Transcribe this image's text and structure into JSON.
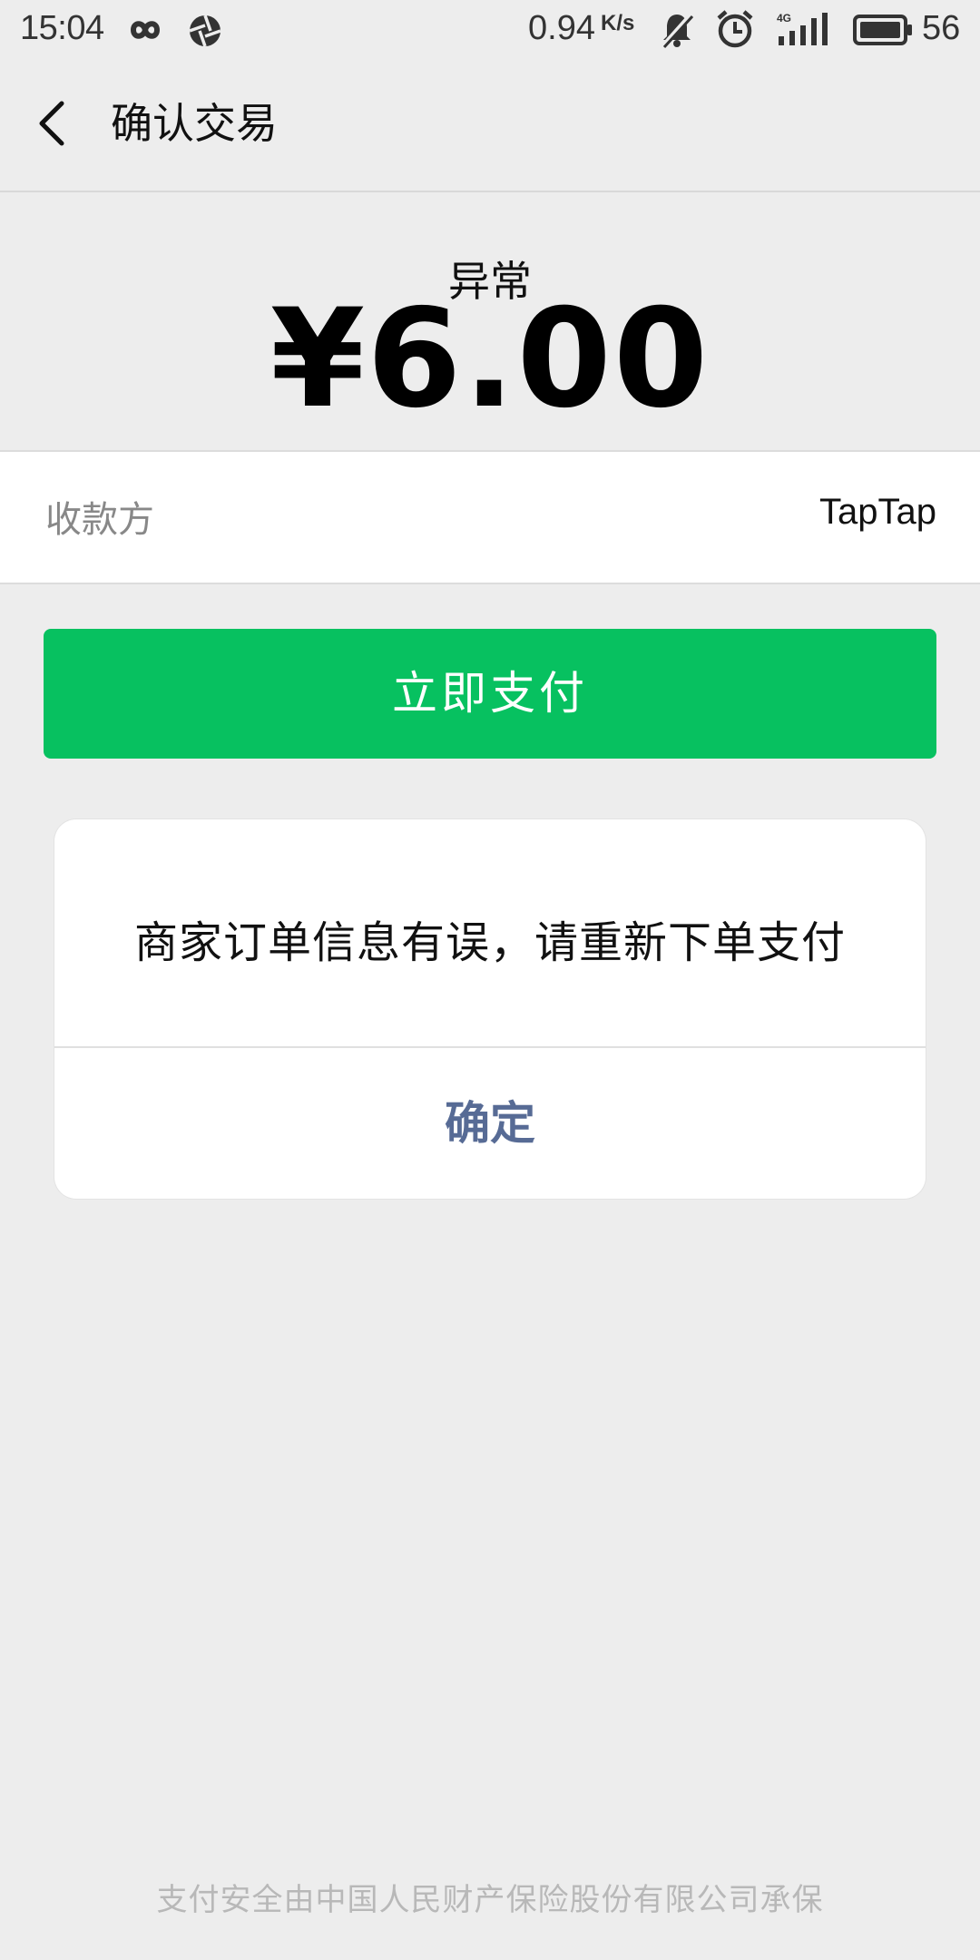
{
  "status_bar": {
    "time": "15:04",
    "net_speed": "0.94",
    "net_speed_unit": "K/s",
    "battery": "56",
    "icons": [
      "infinity-icon",
      "aperture-icon",
      "bell-muted-icon",
      "alarm-icon",
      "signal-4g-icon",
      "battery-icon"
    ]
  },
  "header": {
    "back_icon": "chevron-left-icon",
    "title": "确认交易"
  },
  "amount": {
    "label": "异常",
    "value": "¥6.00"
  },
  "payee": {
    "label": "收款方",
    "value": "TapTap"
  },
  "pay_button": {
    "label": "立即支付",
    "color": "#07c160"
  },
  "dialog": {
    "message": "商家订单信息有误，请重新下单支付",
    "confirm_label": "确定",
    "confirm_color": "#576b95"
  },
  "footer": {
    "note": "支付安全由中国人民财产保险股份有限公司承保"
  }
}
